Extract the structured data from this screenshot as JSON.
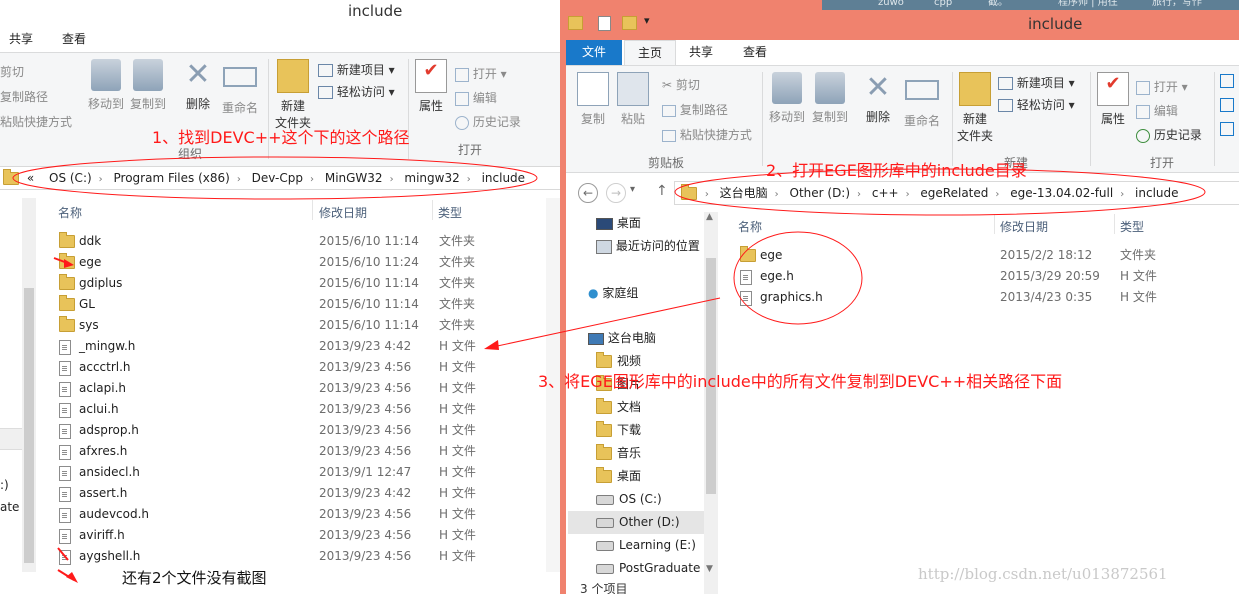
{
  "left_window": {
    "title": "include",
    "tabs": [
      "共享",
      "查看"
    ],
    "ribbon": {
      "cut": "剪切",
      "copy_path": "复制路径",
      "paste_shortcut": "粘贴快捷方式",
      "move_to": "移动到",
      "copy_to": "复制到",
      "delete": "删除",
      "rename": "重命名",
      "new_folder": "新建\n文件夹",
      "new_item": "新建项目",
      "easy_access": "轻松访问",
      "properties": "属性",
      "open": "打开",
      "edit": "编辑",
      "history": "历史记录",
      "group_organize": "组织",
      "group_open": "打开"
    },
    "address": [
      "OS (C:)",
      "Program Files (x86)",
      "Dev-Cpp",
      "MinGW32",
      "mingw32",
      "include"
    ],
    "address_prefix": "«",
    "columns": {
      "name": "名称",
      "date": "修改日期",
      "type": "类型"
    },
    "files": [
      {
        "name": "ddk",
        "date": "2015/6/10 11:14",
        "type": "文件夹",
        "kind": "folder"
      },
      {
        "name": "ege",
        "date": "2015/6/10 11:24",
        "type": "文件夹",
        "kind": "folder"
      },
      {
        "name": "gdiplus",
        "date": "2015/6/10 11:14",
        "type": "文件夹",
        "kind": "folder"
      },
      {
        "name": "GL",
        "date": "2015/6/10 11:14",
        "type": "文件夹",
        "kind": "folder"
      },
      {
        "name": "sys",
        "date": "2015/6/10 11:14",
        "type": "文件夹",
        "kind": "folder"
      },
      {
        "name": "_mingw.h",
        "date": "2013/9/23 4:42",
        "type": "H 文件",
        "kind": "h"
      },
      {
        "name": "accctrl.h",
        "date": "2013/9/23 4:56",
        "type": "H 文件",
        "kind": "h"
      },
      {
        "name": "aclapi.h",
        "date": "2013/9/23 4:56",
        "type": "H 文件",
        "kind": "h"
      },
      {
        "name": "aclui.h",
        "date": "2013/9/23 4:56",
        "type": "H 文件",
        "kind": "h"
      },
      {
        "name": "adsprop.h",
        "date": "2013/9/23 4:56",
        "type": "H 文件",
        "kind": "h"
      },
      {
        "name": "afxres.h",
        "date": "2013/9/23 4:56",
        "type": "H 文件",
        "kind": "h"
      },
      {
        "name": "ansidecl.h",
        "date": "2013/9/1 12:47",
        "type": "H 文件",
        "kind": "h"
      },
      {
        "name": "assert.h",
        "date": "2013/9/23 4:42",
        "type": "H 文件",
        "kind": "h"
      },
      {
        "name": "audevcod.h",
        "date": "2013/9/23 4:56",
        "type": "H 文件",
        "kind": "h"
      },
      {
        "name": "aviriff.h",
        "date": "2013/9/23 4:56",
        "type": "H 文件",
        "kind": "h"
      },
      {
        "name": "aygshell.h",
        "date": "2013/9/23 4:56",
        "type": "H 文件",
        "kind": "h"
      }
    ],
    "nav_fragments": [
      ":)",
      "ate"
    ]
  },
  "right_window": {
    "title": "include",
    "tabs": [
      "文件",
      "主页",
      "共享",
      "查看"
    ],
    "ribbon": {
      "copy": "复制",
      "paste": "粘贴",
      "cut": "剪切",
      "copy_path": "复制路径",
      "paste_shortcut": "粘贴快捷方式",
      "move_to": "移动到",
      "copy_to": "复制到",
      "delete": "删除",
      "rename": "重命名",
      "new_folder": "新建\n文件夹",
      "new_item": "新建项目",
      "easy_access": "轻松访问",
      "properties": "属性",
      "open": "打开",
      "edit": "编辑",
      "history": "历史记录",
      "group_clipboard": "剪贴板",
      "group_new": "新建",
      "group_open": "打开"
    },
    "address": [
      "这台电脑",
      "Other (D:)",
      "c++",
      "egeRelated",
      "ege-13.04.02-full",
      "include"
    ],
    "nav": {
      "favorites": [
        "桌面",
        "最近访问的位置"
      ],
      "homegroup": "家庭组",
      "this_pc": "这台电脑",
      "pc_items": [
        "视频",
        "图片",
        "文档",
        "下载",
        "音乐",
        "桌面",
        "OS (C:)",
        "Other (D:)",
        "Learning (E:)",
        "PostGraduate"
      ]
    },
    "columns": {
      "name": "名称",
      "date": "修改日期",
      "type": "类型"
    },
    "files": [
      {
        "name": "ege",
        "date": "2015/2/2 18:12",
        "type": "文件夹",
        "kind": "folder"
      },
      {
        "name": "ege.h",
        "date": "2015/3/29 20:59",
        "type": "H 文件",
        "kind": "h"
      },
      {
        "name": "graphics.h",
        "date": "2013/4/23 0:35",
        "type": "H 文件",
        "kind": "h"
      }
    ],
    "status": "3 个项目"
  },
  "taskbar_fragments": [
    "zuwo",
    "cpp",
    "截。",
    "程序帅 | 用往",
    "旅行，写作"
  ],
  "annotations": {
    "step1": "1、找到DEVC++这个下的这个路径",
    "step2": "2、打开EGE图形库中的include目录",
    "step3": "3、将EGE图形库中的include中的所有文件复制到DEVC++相关路径下面",
    "note": "还有2个文件没有截图"
  },
  "watermark": "http://blog.csdn.net/u013872561",
  "colors": {
    "accent": "#1979ca",
    "annotation": "#ff1a1a",
    "right_border": "#f0826e",
    "folder": "#e8c35a"
  }
}
